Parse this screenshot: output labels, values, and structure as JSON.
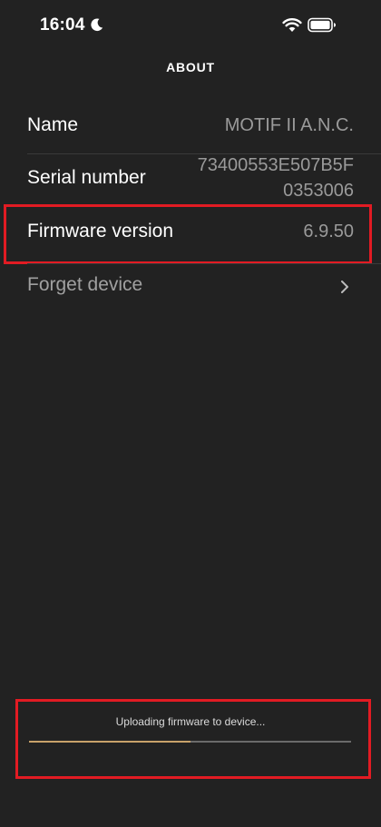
{
  "status_bar": {
    "time": "16:04",
    "icons": [
      "moon-icon",
      "wifi-icon",
      "battery-icon"
    ]
  },
  "header": {
    "title": "ABOUT"
  },
  "rows": {
    "name": {
      "label": "Name",
      "value": "MOTIF II A.N.C."
    },
    "serial": {
      "label": "Serial number",
      "value_line1": "73400553E507B5F",
      "value_line2": "0353006"
    },
    "firmware": {
      "label": "Firmware version",
      "value": "6.9.50"
    },
    "forget": {
      "label": "Forget device",
      "icon": "chevron-right-icon"
    }
  },
  "upload": {
    "status_text": "Uploading firmware to device...",
    "progress": 0.5
  },
  "colors": {
    "background": "#222222",
    "value_text": "#9a9a9a",
    "muted_label": "#a0a0a0",
    "highlight": "#e21b23",
    "progress_fill": "#c8a26a",
    "progress_track": "#6b6b6b"
  }
}
